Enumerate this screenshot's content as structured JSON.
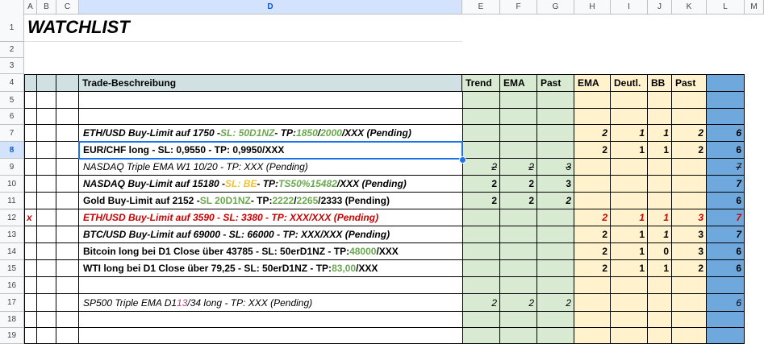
{
  "columns": [
    "A",
    "B",
    "C",
    "D",
    "E",
    "F",
    "G",
    "H",
    "I",
    "J",
    "K",
    "L",
    "M"
  ],
  "rows": [
    "1",
    "2",
    "3",
    "4",
    "5",
    "6",
    "7",
    "8",
    "9",
    "10",
    "11",
    "12",
    "13",
    "14",
    "15",
    "16",
    "17",
    "18",
    "19"
  ],
  "title": "WATCHLIST",
  "headers": {
    "trade": "Trade-Beschreibung",
    "trend": "Trend",
    "ema1": "EMA",
    "past1": "Past",
    "ema2": "EMA",
    "deutl": "Deutl.",
    "bb": "BB",
    "past2": "Past"
  },
  "trades": {
    "r7": {
      "p1": "ETH/USD Buy-Limit auf 1750 - ",
      "p2": "SL: 50D1NZ",
      "p3": " - TP: ",
      "p4": "1850",
      "p5": "/",
      "p6": "2000",
      "p7": "/XXX (Pending)",
      "h": "2",
      "i": "1",
      "j": "1",
      "k": "2",
      "l": "6"
    },
    "r8": {
      "text": "EUR/CHF long - SL: 0,9550 - TP: 0,9950/XXX",
      "h": "2",
      "i": "1",
      "j": "1",
      "k": "2",
      "l": "6"
    },
    "r9": {
      "text": "NASDAQ Triple EMA W1 10/20 - TP: XXX (Pending)",
      "e": "2",
      "f": "2",
      "g": "3",
      "l": "7"
    },
    "r10": {
      "p1": "NASDAQ Buy-Limit auf 15180 - ",
      "p2": "SL: BE",
      "p3": " - TP: ",
      "p4": "TS50%15482",
      "p5": "/XXX (Pending)",
      "e": "2",
      "f": "2",
      "g": "3",
      "l": "7"
    },
    "r11": {
      "p1": "Gold Buy-Limit auf 2152 - ",
      "p2": "SL 20D1NZ",
      "p3": " - TP: ",
      "p4": "2222",
      "p5": "/",
      "p6": "2265",
      "p7": "/2333 (Pending)",
      "e": "2",
      "f": "2",
      "g": "2",
      "l": "6"
    },
    "r12": {
      "marker": "x",
      "text": "ETH/USD Buy-Limit auf 3590 - SL: 3380 - TP: XXX/XXX (Pending)",
      "h": "2",
      "i": "1",
      "j": "1",
      "k": "3",
      "l": "7"
    },
    "r13": {
      "text": "BTC/USD Buy-Limit auf 69000 - SL: 66000 - TP: XXX/XXX (Pending)",
      "h": "2",
      "i": "1",
      "j": "1",
      "k": "3",
      "l": "7"
    },
    "r14": {
      "p1": "Bitcoin long bei D1 Close über 43785 - SL: 50erD1NZ - TP: ",
      "p2": "48000",
      "p3": "/XXX",
      "h": "2",
      "i": "1",
      "j": "0",
      "k": "3",
      "l": "6"
    },
    "r15": {
      "p1": "WTI long bei D1 Close über 79,25 - SL: 50erD1NZ - TP: ",
      "p2": "83,00",
      "p3": "/XXX",
      "h": "2",
      "i": "1",
      "j": "1",
      "k": "2",
      "l": "6"
    },
    "r17": {
      "p1": "SP500 Triple EMA D1 ",
      "p2": "13",
      "p3": "/34 long - TP: XXX (Pending)",
      "e": "2",
      "f": "2",
      "g": "2",
      "l": "6"
    }
  },
  "colors": {
    "green_fill": "#d9ead3",
    "yellow_fill": "#fff2cc",
    "blue_fill": "#6fa8dc",
    "header_gray": "#d0e0e3",
    "selection": "#1a73e8"
  }
}
